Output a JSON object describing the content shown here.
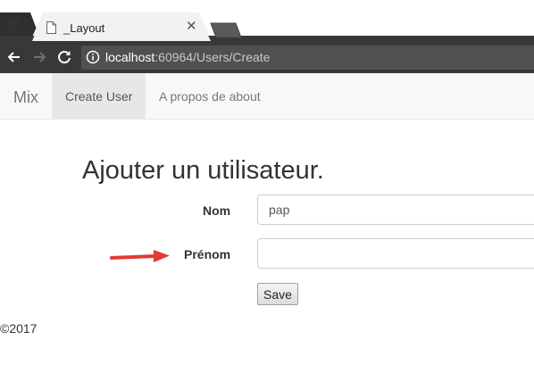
{
  "browser": {
    "tab_title": "_Layout",
    "url_host": "localhost",
    "url_rest": ":60964/Users/Create",
    "icons": [
      "incognito-icon",
      "page-icon",
      "close-icon",
      "back-icon",
      "forward-icon",
      "reload-icon",
      "info-icon"
    ]
  },
  "navbar": {
    "brand": "Mix",
    "links": [
      {
        "label": "Create User",
        "active": true
      },
      {
        "label": "A propos de about",
        "active": false
      }
    ]
  },
  "form": {
    "title": "Ajouter un utilisateur.",
    "nom_label": "Nom",
    "nom_value": "pap",
    "prenom_label": "Prénom",
    "prenom_value": "",
    "save_label": "Save"
  },
  "annotation": {
    "arrow_color": "#e53935"
  },
  "footer": {
    "text": "©2017"
  }
}
